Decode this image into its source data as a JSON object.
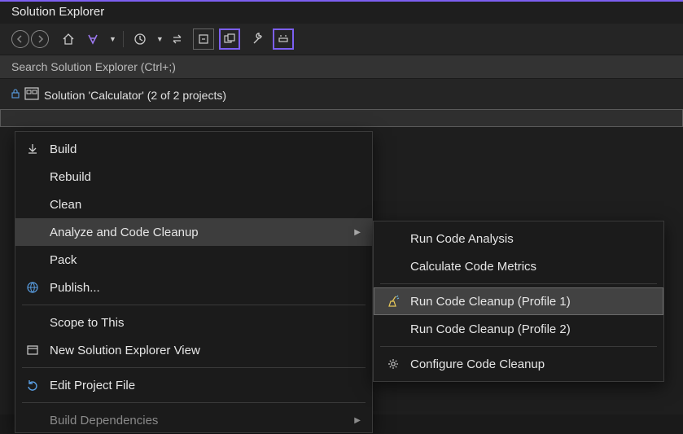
{
  "panel": {
    "title": "Solution Explorer"
  },
  "search": {
    "placeholder": "Search Solution Explorer (Ctrl+;)"
  },
  "tree": {
    "solution": "Solution 'Calculator' (2 of 2 projects)"
  },
  "menu": {
    "items": [
      {
        "label": "Build",
        "icon": "download"
      },
      {
        "label": "Rebuild",
        "icon": ""
      },
      {
        "label": "Clean",
        "icon": ""
      },
      {
        "label": "Analyze and Code Cleanup",
        "icon": "",
        "submenu": true,
        "highlight": true
      },
      {
        "label": "Pack",
        "icon": ""
      },
      {
        "label": "Publish...",
        "icon": "globe"
      },
      {
        "sep": true
      },
      {
        "label": "Scope to This",
        "icon": ""
      },
      {
        "label": "New Solution Explorer View",
        "icon": "window"
      },
      {
        "sep": true
      },
      {
        "label": "Edit Project File",
        "icon": "refresh"
      },
      {
        "sep": true
      },
      {
        "label": "Build Dependencies",
        "icon": "",
        "submenu": true,
        "dim": true
      }
    ]
  },
  "submenu": {
    "items": [
      {
        "label": "Run Code Analysis",
        "icon": ""
      },
      {
        "label": "Calculate Code Metrics",
        "icon": ""
      },
      {
        "sep": true
      },
      {
        "label": "Run Code Cleanup (Profile 1)",
        "icon": "broom",
        "highlight": true
      },
      {
        "label": "Run Code Cleanup (Profile 2)",
        "icon": ""
      },
      {
        "sep": true
      },
      {
        "label": "Configure Code Cleanup",
        "icon": "gear"
      }
    ]
  }
}
